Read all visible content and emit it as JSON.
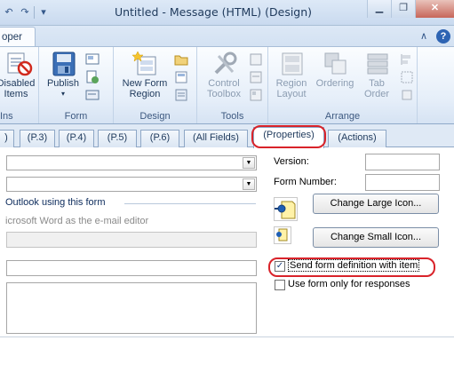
{
  "window": {
    "title": "Untitled  -  Message (HTML)  (Design)",
    "minimize_icon": "minimize-icon",
    "maximize_icon": "restore-icon",
    "close_icon": "close-icon"
  },
  "ribbon_tab": {
    "label": "oper"
  },
  "ribbon": {
    "groups": [
      {
        "label": "Ins",
        "buttons": [
          {
            "label": "Disabled\nItems",
            "icon": "disabled-items-icon"
          }
        ]
      },
      {
        "label": "Form",
        "buttons": [
          {
            "label": "Publish",
            "icon": "publish-icon"
          }
        ]
      },
      {
        "label": "Design",
        "buttons": [
          {
            "label": "New Form\nRegion",
            "icon": "new-form-region-icon"
          }
        ]
      },
      {
        "label": "Tools",
        "buttons": [
          {
            "label": "Control\nToolbox",
            "icon": "control-toolbox-icon"
          }
        ]
      },
      {
        "label": "Arrange",
        "buttons": [
          {
            "label": "Region\nLayout",
            "icon": "region-layout-icon"
          },
          {
            "label": "Ordering",
            "icon": "ordering-icon"
          },
          {
            "label": "Tab\nOrder",
            "icon": "tab-order-icon"
          }
        ]
      }
    ]
  },
  "page_tabs": [
    {
      "label": ")"
    },
    {
      "label": "(P.3)"
    },
    {
      "label": "(P.4)"
    },
    {
      "label": "(P.5)"
    },
    {
      "label": "(P.6)"
    },
    {
      "label": "(All Fields)"
    },
    {
      "label": "(Properties)",
      "active": true
    },
    {
      "label": "(Actions)"
    }
  ],
  "properties": {
    "section_title": "Outlook using this form",
    "word_editor_label": "icrosoft Word as the e-mail editor",
    "version_label": "Version:",
    "form_number_label": "Form Number:",
    "change_large_icon": "Change Large Icon...",
    "change_small_icon": "Change Small Icon...",
    "send_form_definition": "Send form definition with item",
    "send_form_definition_checked": true,
    "use_for_responses": "Use form only for responses",
    "use_for_responses_checked": false
  },
  "colors": {
    "highlight": "#d9232a",
    "ribbon_text": "#1e395b"
  }
}
